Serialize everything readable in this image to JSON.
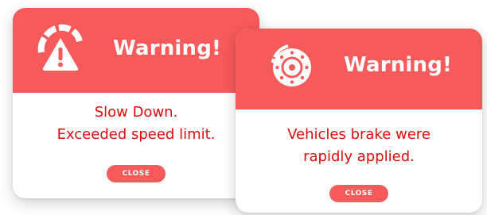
{
  "colors": {
    "header": "#f75a5a",
    "message": "#dd0d0d",
    "button": "#f75a5a",
    "button_text": "#ffffff"
  },
  "alerts": [
    {
      "icon": "speedometer-warning-icon",
      "title": "Warning!",
      "message_lines": [
        "Slow Down.",
        "Exceeded speed limit."
      ],
      "close_label": "CLOSE"
    },
    {
      "icon": "brake-disc-icon",
      "title": "Warning!",
      "message_lines": [
        "Vehicles brake were",
        "rapidly applied."
      ],
      "close_label": "CLOSE"
    }
  ]
}
